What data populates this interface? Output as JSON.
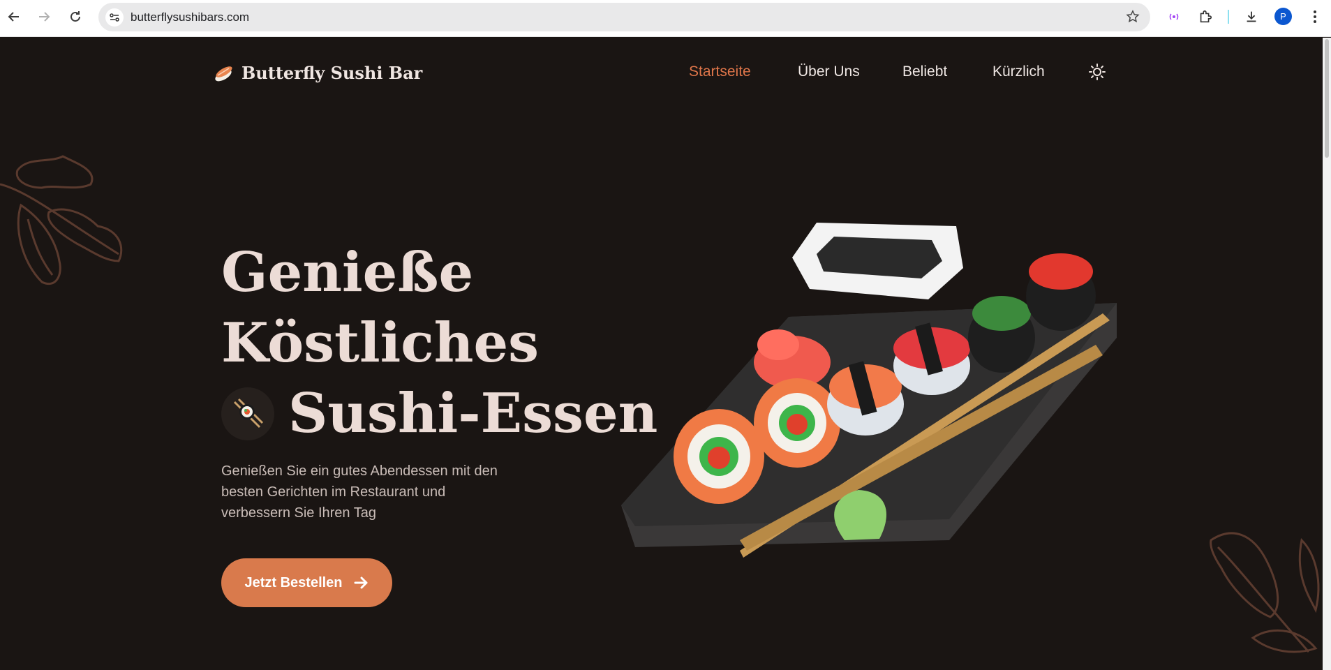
{
  "browser": {
    "url": "butterflysushibars.com",
    "profile_initial": "P",
    "icons": [
      "back-icon",
      "forward-icon",
      "reload-icon",
      "site-info-icon",
      "bookmark-star-icon",
      "broadcast-icon",
      "extensions-icon",
      "download-icon",
      "menu-icon"
    ]
  },
  "header": {
    "brand": "Butterfly Sushi Bar",
    "nav": [
      {
        "label": "Startseite",
        "active": true
      },
      {
        "label": "Über Uns",
        "active": false
      },
      {
        "label": "Beliebt",
        "active": false
      },
      {
        "label": "Kürzlich",
        "active": false
      }
    ]
  },
  "hero": {
    "title_line1": "Genieße",
    "title_line2": "Köstliches",
    "title_line3": "Sushi-Essen",
    "description": "Genießen Sie ein gutes Abendessen mit den besten Gerichten im Restaurant und verbessern Sie Ihren Tag",
    "cta_label": "Jetzt Bestellen"
  },
  "colors": {
    "background": "#1a1513",
    "accent": "#d97a4c",
    "nav_active": "#e0764a",
    "title": "#ecdcd6"
  }
}
